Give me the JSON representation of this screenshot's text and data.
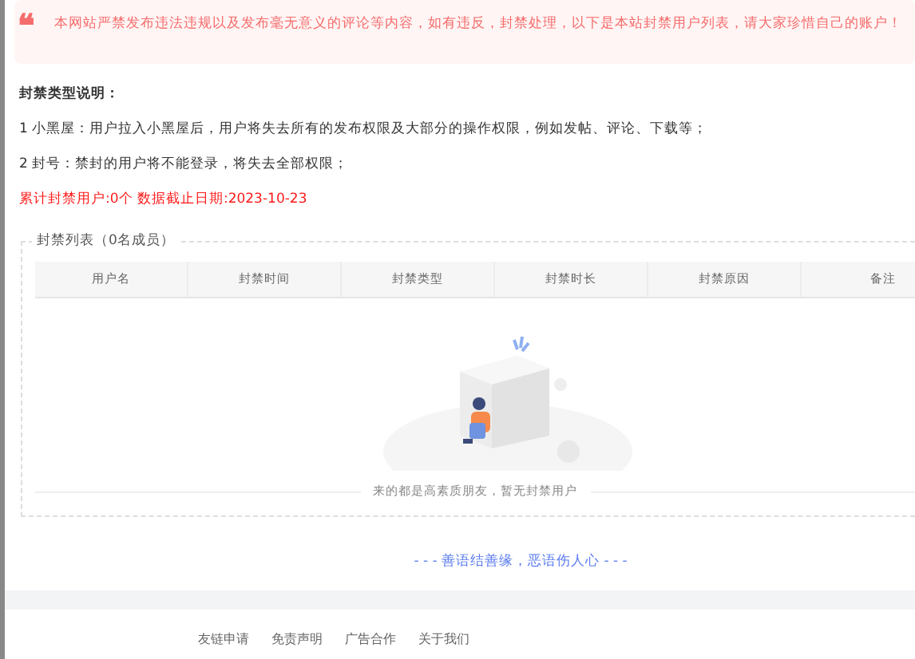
{
  "notice": {
    "icon": "❝",
    "text": "本网站严禁发布违法违规以及发布毫无意义的评论等内容，如有违反，封禁处理，以下是本站封禁用户列表，请大家珍惜自己的账户！"
  },
  "explanation": {
    "title": "封禁类型说明：",
    "items": [
      "1 小黑屋：用户拉入小黑屋后，用户将失去所有的发布权限及大部分的操作权限，例如发帖、评论、下载等；",
      "2 封号：禁封的用户将不能登录，将失去全部权限；"
    ],
    "summary": "累计封禁用户:0个 数据截止日期:2023-10-23"
  },
  "ban_list": {
    "legend": "封禁列表（0名成员）",
    "columns": [
      "用户名",
      "封禁时间",
      "封禁类型",
      "封禁时长",
      "封禁原因",
      "备注"
    ],
    "empty_text": "来的都是高素质朋友，暂无封禁用户"
  },
  "slogan": "- - - 善语结善缘，恶语伤人心 - - -",
  "footer_links": [
    "友链申请",
    "免责声明",
    "广告合作",
    "关于我们"
  ]
}
